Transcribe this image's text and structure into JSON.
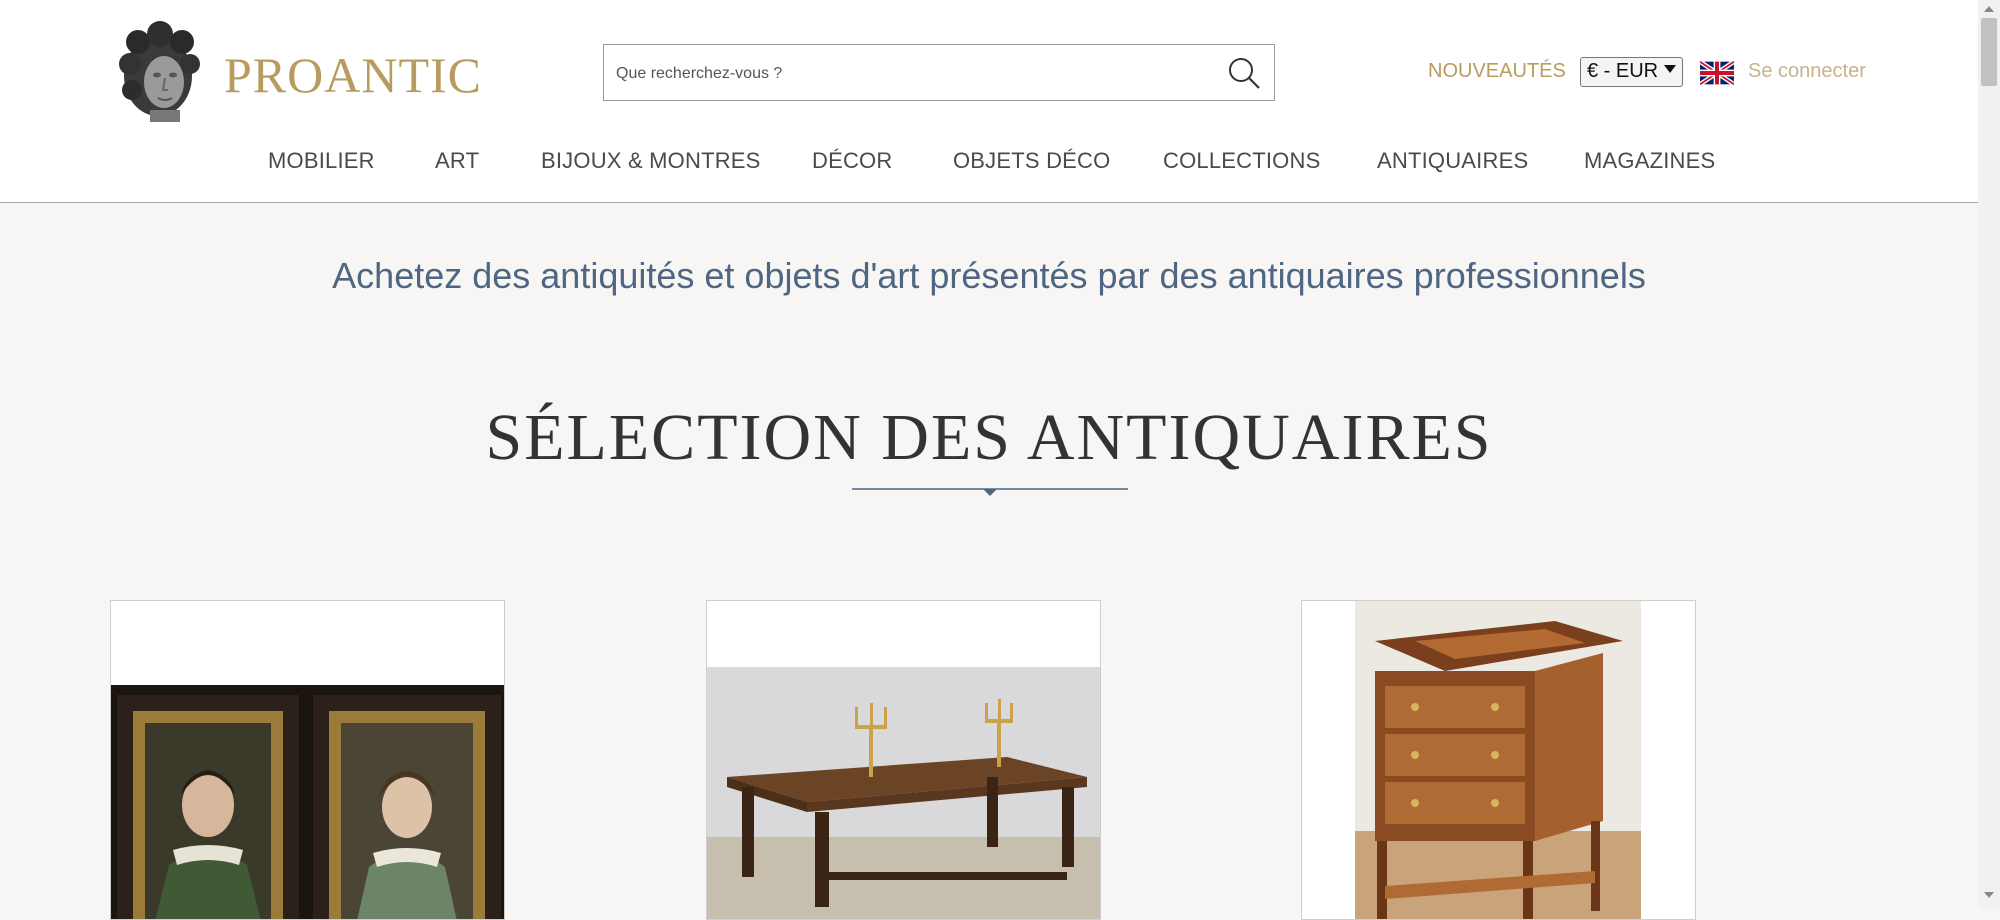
{
  "brand": {
    "name": "PROANTIC",
    "logo_icon": "sculpted-head-logo-icon"
  },
  "search": {
    "placeholder": "Que recherchez-vous ?",
    "value": "",
    "icon": "search-icon"
  },
  "header": {
    "nouveautes_label": "NOUVEAUTÉS",
    "currency": {
      "selected": "€ - EUR"
    },
    "language_icon": "uk-flag-icon",
    "signin_label": "Se connecter"
  },
  "nav": {
    "items": [
      {
        "label": "MOBILIER"
      },
      {
        "label": "ART"
      },
      {
        "label": "BIJOUX & MONTRES"
      },
      {
        "label": "DÉCOR"
      },
      {
        "label": "OBJETS DÉCO"
      },
      {
        "label": "COLLECTIONS"
      },
      {
        "label": "ANTIQUAIRES"
      },
      {
        "label": "MAGAZINES"
      }
    ]
  },
  "main": {
    "tagline": "Achetez des antiquités et objets d'art présentés par des antiquaires professionnels",
    "section_title": "SÉLECTION DES ANTIQUAIRES",
    "cards": [
      {
        "image": "pair-of-portrait-paintings"
      },
      {
        "image": "long-wooden-table-with-candelabras"
      },
      {
        "image": "marquetry-side-table"
      }
    ]
  },
  "colors": {
    "brand_gold": "#b89b5e",
    "tagline_blue": "#4f6682",
    "background": "#f7f6f4"
  }
}
